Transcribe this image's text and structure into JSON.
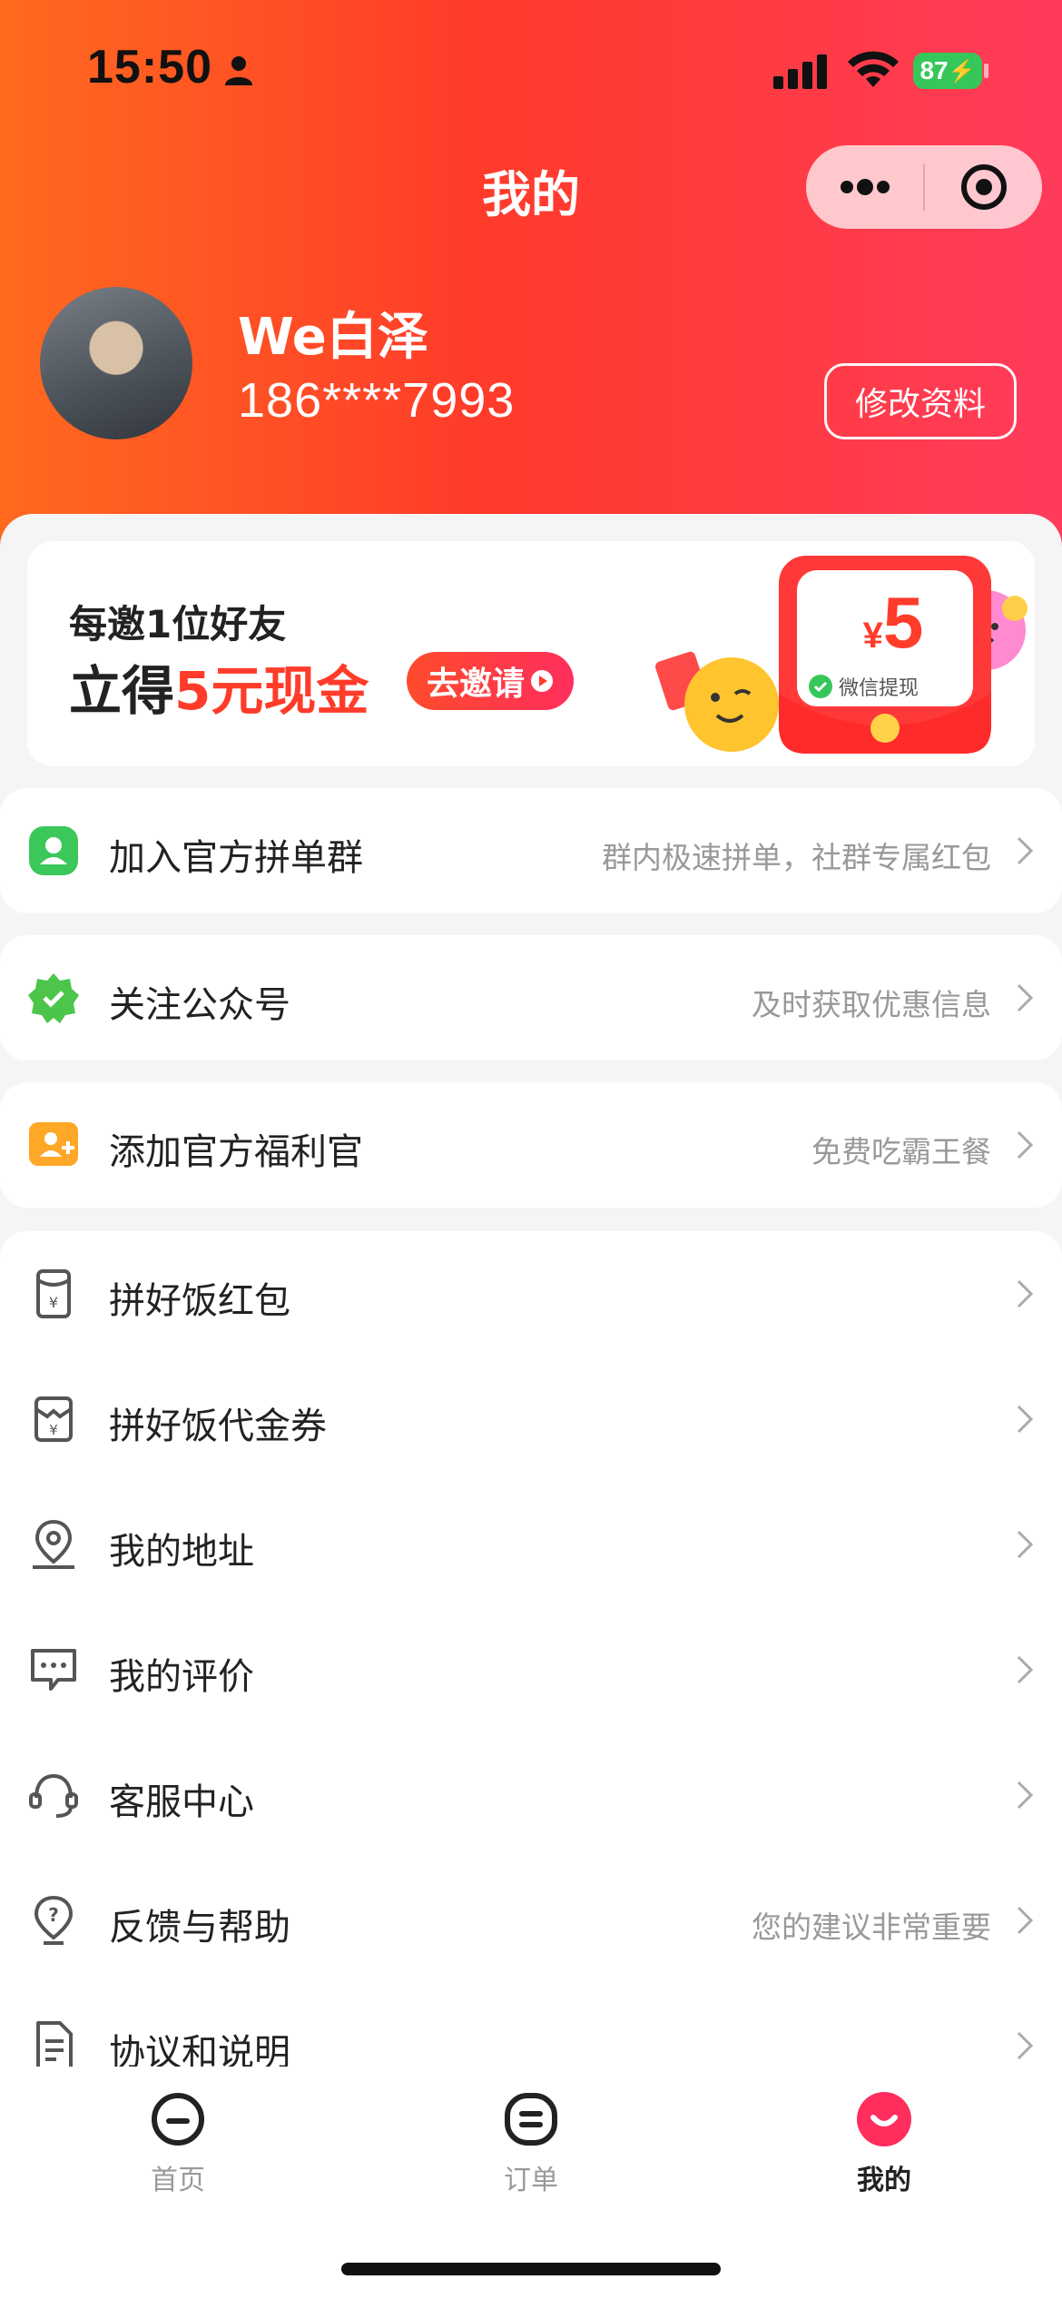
{
  "status_bar": {
    "time": "15:50",
    "battery": "87"
  },
  "nav": {
    "title": "我的"
  },
  "profile": {
    "name": "We白泽",
    "phone": "186****7993",
    "edit_label": "修改资料"
  },
  "banner": {
    "line1": "每邀1位好友",
    "line2_prefix": "立得",
    "line2_highlight": "5元现金",
    "cta": "去邀请",
    "currency": "¥",
    "amount": "5",
    "withdraw_label": "微信提现"
  },
  "promo_rows": [
    {
      "label": "加入官方拼单群",
      "hint": "群内极速拼单，社群专属红包",
      "icon": "group-chat-icon"
    },
    {
      "label": "关注公众号",
      "hint": "及时获取优惠信息",
      "icon": "verified-badge-icon"
    },
    {
      "label": "添加官方福利官",
      "hint": "免费吃霸王餐",
      "icon": "add-contact-icon"
    }
  ],
  "menu_rows": [
    {
      "label": "拼好饭红包",
      "hint": "",
      "icon": "red-packet-icon"
    },
    {
      "label": "拼好饭代金券",
      "hint": "",
      "icon": "voucher-icon"
    },
    {
      "label": "我的地址",
      "hint": "",
      "icon": "location-icon"
    },
    {
      "label": "我的评价",
      "hint": "",
      "icon": "comment-icon"
    },
    {
      "label": "客服中心",
      "hint": "",
      "icon": "headset-icon"
    },
    {
      "label": "反馈与帮助",
      "hint": "您的建议非常重要",
      "icon": "help-icon"
    },
    {
      "label": "协议和说明",
      "hint": "",
      "icon": "document-icon"
    }
  ],
  "tabbar": {
    "tabs": [
      {
        "label": "首页",
        "icon": "home-icon",
        "active": false
      },
      {
        "label": "订单",
        "icon": "orders-icon",
        "active": false
      },
      {
        "label": "我的",
        "icon": "profile-icon",
        "active": true
      }
    ]
  },
  "colors": {
    "accent": "#ff3b2a",
    "header_start": "#ff6a1e",
    "header_end": "#ff3b5c",
    "wechat_green": "#35c759"
  }
}
